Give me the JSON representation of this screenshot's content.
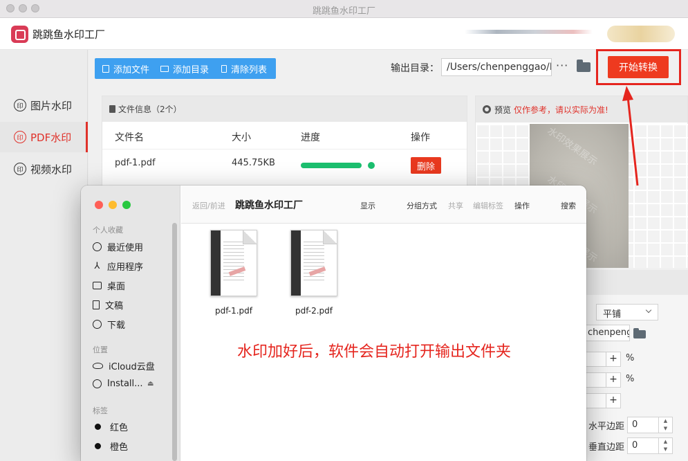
{
  "window": {
    "title": "跳跳鱼水印工厂"
  },
  "app": {
    "name": "跳跳鱼水印工厂"
  },
  "sidebar": {
    "items": [
      {
        "label": "图片水印",
        "icon": "印"
      },
      {
        "label": "PDF水印",
        "icon": "印",
        "active": true
      },
      {
        "label": "视频水印",
        "icon": "印"
      }
    ]
  },
  "toolbar": {
    "add_file": "添加文件",
    "add_dir": "添加目录",
    "clear_list": "清除列表",
    "output_label": "输出目录：",
    "output_path": "/Users/chenpenggao/D",
    "more": "···",
    "start": "开始转换"
  },
  "fileinfo": {
    "title": "文件信息（2个）",
    "columns": [
      "文件名",
      "大小",
      "进度",
      "操作"
    ],
    "rows": [
      {
        "name": "pdf-1.pdf",
        "size": "445.75KB",
        "progress": 1.0,
        "action": "删除"
      }
    ]
  },
  "preview": {
    "title": "预览",
    "note": "仅作参考，请以实际为准!",
    "watermark": "水印效果展示"
  },
  "settings": {
    "layout": "平铺",
    "path": "chenpengga",
    "h_margin_label": "水平边距",
    "h_margin_value": "0",
    "v_margin_label": "垂直边距",
    "v_margin_value": "0",
    "pct": "%",
    "plus": "+"
  },
  "finder": {
    "nav": "返回/前进",
    "title": "跳跳鱼水印工厂",
    "toolbar": [
      "显示",
      "分组方式",
      "共享",
      "编辑标签",
      "操作",
      "搜索"
    ],
    "sections": {
      "favorites": "个人收藏",
      "locations": "位置",
      "tags": "标签"
    },
    "favorites": [
      "最近使用",
      "应用程序",
      "桌面",
      "文稿",
      "下载"
    ],
    "locations": [
      "iCloud云盘",
      "Install..."
    ],
    "tags": [
      "红色",
      "橙色"
    ],
    "files": [
      "pdf-1.pdf",
      "pdf-2.pdf"
    ],
    "note": "水印加好后，软件会自动打开输出文件夹"
  },
  "colors": {
    "accent": "#e5251e",
    "blue": "#3ea0f0",
    "green": "#1cbf6f"
  }
}
